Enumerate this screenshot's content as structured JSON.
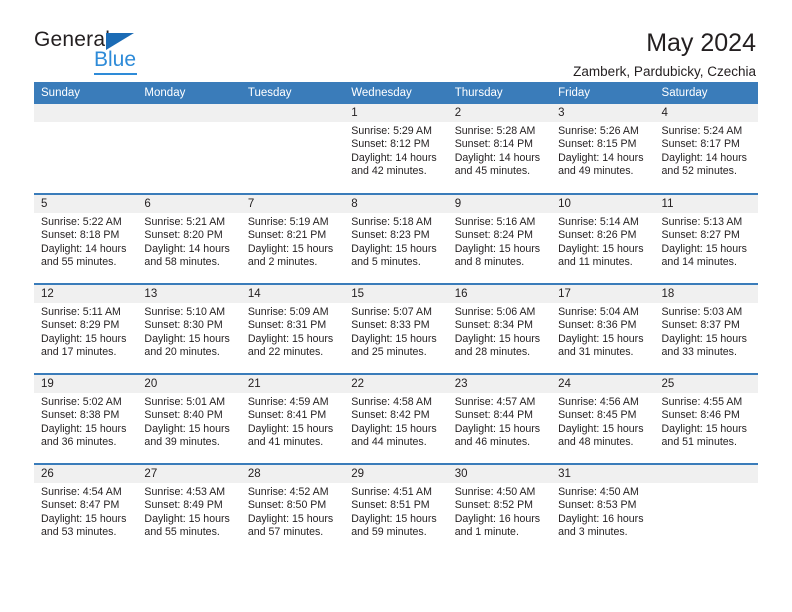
{
  "brand": {
    "name_dark": "General",
    "name_light": "Blue",
    "triangle_color": "#1b6bb5",
    "light_color": "#2e8bd8"
  },
  "header": {
    "title": "May 2024",
    "subtitle": "Zamberk, Pardubicky, Czechia"
  },
  "calendar": {
    "accent_color": "#3a7cba",
    "daynum_bg": "#f0f0f0",
    "weekday_headers": [
      "Sunday",
      "Monday",
      "Tuesday",
      "Wednesday",
      "Thursday",
      "Friday",
      "Saturday"
    ],
    "weeks": [
      [
        {
          "day": "",
          "empty": true
        },
        {
          "day": "",
          "empty": true
        },
        {
          "day": "",
          "empty": true
        },
        {
          "day": "1",
          "sunrise": "Sunrise: 5:29 AM",
          "sunset": "Sunset: 8:12 PM",
          "daylight1": "Daylight: 14 hours",
          "daylight2": "and 42 minutes."
        },
        {
          "day": "2",
          "sunrise": "Sunrise: 5:28 AM",
          "sunset": "Sunset: 8:14 PM",
          "daylight1": "Daylight: 14 hours",
          "daylight2": "and 45 minutes."
        },
        {
          "day": "3",
          "sunrise": "Sunrise: 5:26 AM",
          "sunset": "Sunset: 8:15 PM",
          "daylight1": "Daylight: 14 hours",
          "daylight2": "and 49 minutes."
        },
        {
          "day": "4",
          "sunrise": "Sunrise: 5:24 AM",
          "sunset": "Sunset: 8:17 PM",
          "daylight1": "Daylight: 14 hours",
          "daylight2": "and 52 minutes."
        }
      ],
      [
        {
          "day": "5",
          "sunrise": "Sunrise: 5:22 AM",
          "sunset": "Sunset: 8:18 PM",
          "daylight1": "Daylight: 14 hours",
          "daylight2": "and 55 minutes."
        },
        {
          "day": "6",
          "sunrise": "Sunrise: 5:21 AM",
          "sunset": "Sunset: 8:20 PM",
          "daylight1": "Daylight: 14 hours",
          "daylight2": "and 58 minutes."
        },
        {
          "day": "7",
          "sunrise": "Sunrise: 5:19 AM",
          "sunset": "Sunset: 8:21 PM",
          "daylight1": "Daylight: 15 hours",
          "daylight2": "and 2 minutes."
        },
        {
          "day": "8",
          "sunrise": "Sunrise: 5:18 AM",
          "sunset": "Sunset: 8:23 PM",
          "daylight1": "Daylight: 15 hours",
          "daylight2": "and 5 minutes."
        },
        {
          "day": "9",
          "sunrise": "Sunrise: 5:16 AM",
          "sunset": "Sunset: 8:24 PM",
          "daylight1": "Daylight: 15 hours",
          "daylight2": "and 8 minutes."
        },
        {
          "day": "10",
          "sunrise": "Sunrise: 5:14 AM",
          "sunset": "Sunset: 8:26 PM",
          "daylight1": "Daylight: 15 hours",
          "daylight2": "and 11 minutes."
        },
        {
          "day": "11",
          "sunrise": "Sunrise: 5:13 AM",
          "sunset": "Sunset: 8:27 PM",
          "daylight1": "Daylight: 15 hours",
          "daylight2": "and 14 minutes."
        }
      ],
      [
        {
          "day": "12",
          "sunrise": "Sunrise: 5:11 AM",
          "sunset": "Sunset: 8:29 PM",
          "daylight1": "Daylight: 15 hours",
          "daylight2": "and 17 minutes."
        },
        {
          "day": "13",
          "sunrise": "Sunrise: 5:10 AM",
          "sunset": "Sunset: 8:30 PM",
          "daylight1": "Daylight: 15 hours",
          "daylight2": "and 20 minutes."
        },
        {
          "day": "14",
          "sunrise": "Sunrise: 5:09 AM",
          "sunset": "Sunset: 8:31 PM",
          "daylight1": "Daylight: 15 hours",
          "daylight2": "and 22 minutes."
        },
        {
          "day": "15",
          "sunrise": "Sunrise: 5:07 AM",
          "sunset": "Sunset: 8:33 PM",
          "daylight1": "Daylight: 15 hours",
          "daylight2": "and 25 minutes."
        },
        {
          "day": "16",
          "sunrise": "Sunrise: 5:06 AM",
          "sunset": "Sunset: 8:34 PM",
          "daylight1": "Daylight: 15 hours",
          "daylight2": "and 28 minutes."
        },
        {
          "day": "17",
          "sunrise": "Sunrise: 5:04 AM",
          "sunset": "Sunset: 8:36 PM",
          "daylight1": "Daylight: 15 hours",
          "daylight2": "and 31 minutes."
        },
        {
          "day": "18",
          "sunrise": "Sunrise: 5:03 AM",
          "sunset": "Sunset: 8:37 PM",
          "daylight1": "Daylight: 15 hours",
          "daylight2": "and 33 minutes."
        }
      ],
      [
        {
          "day": "19",
          "sunrise": "Sunrise: 5:02 AM",
          "sunset": "Sunset: 8:38 PM",
          "daylight1": "Daylight: 15 hours",
          "daylight2": "and 36 minutes."
        },
        {
          "day": "20",
          "sunrise": "Sunrise: 5:01 AM",
          "sunset": "Sunset: 8:40 PM",
          "daylight1": "Daylight: 15 hours",
          "daylight2": "and 39 minutes."
        },
        {
          "day": "21",
          "sunrise": "Sunrise: 4:59 AM",
          "sunset": "Sunset: 8:41 PM",
          "daylight1": "Daylight: 15 hours",
          "daylight2": "and 41 minutes."
        },
        {
          "day": "22",
          "sunrise": "Sunrise: 4:58 AM",
          "sunset": "Sunset: 8:42 PM",
          "daylight1": "Daylight: 15 hours",
          "daylight2": "and 44 minutes."
        },
        {
          "day": "23",
          "sunrise": "Sunrise: 4:57 AM",
          "sunset": "Sunset: 8:44 PM",
          "daylight1": "Daylight: 15 hours",
          "daylight2": "and 46 minutes."
        },
        {
          "day": "24",
          "sunrise": "Sunrise: 4:56 AM",
          "sunset": "Sunset: 8:45 PM",
          "daylight1": "Daylight: 15 hours",
          "daylight2": "and 48 minutes."
        },
        {
          "day": "25",
          "sunrise": "Sunrise: 4:55 AM",
          "sunset": "Sunset: 8:46 PM",
          "daylight1": "Daylight: 15 hours",
          "daylight2": "and 51 minutes."
        }
      ],
      [
        {
          "day": "26",
          "sunrise": "Sunrise: 4:54 AM",
          "sunset": "Sunset: 8:47 PM",
          "daylight1": "Daylight: 15 hours",
          "daylight2": "and 53 minutes."
        },
        {
          "day": "27",
          "sunrise": "Sunrise: 4:53 AM",
          "sunset": "Sunset: 8:49 PM",
          "daylight1": "Daylight: 15 hours",
          "daylight2": "and 55 minutes."
        },
        {
          "day": "28",
          "sunrise": "Sunrise: 4:52 AM",
          "sunset": "Sunset: 8:50 PM",
          "daylight1": "Daylight: 15 hours",
          "daylight2": "and 57 minutes."
        },
        {
          "day": "29",
          "sunrise": "Sunrise: 4:51 AM",
          "sunset": "Sunset: 8:51 PM",
          "daylight1": "Daylight: 15 hours",
          "daylight2": "and 59 minutes."
        },
        {
          "day": "30",
          "sunrise": "Sunrise: 4:50 AM",
          "sunset": "Sunset: 8:52 PM",
          "daylight1": "Daylight: 16 hours",
          "daylight2": "and 1 minute."
        },
        {
          "day": "31",
          "sunrise": "Sunrise: 4:50 AM",
          "sunset": "Sunset: 8:53 PM",
          "daylight1": "Daylight: 16 hours",
          "daylight2": "and 3 minutes."
        },
        {
          "day": "",
          "empty": true
        }
      ]
    ]
  }
}
